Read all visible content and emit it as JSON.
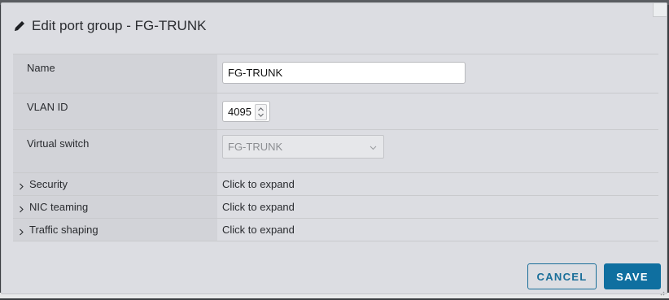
{
  "dialog": {
    "title": "Edit port group - FG-TRUNK",
    "title_icon": "pencil-icon"
  },
  "form": {
    "name_label": "Name",
    "name_value": "FG-TRUNK",
    "vlan_label": "VLAN ID",
    "vlan_value": "4095",
    "vswitch_label": "Virtual switch",
    "vswitch_value": "FG-TRUNK",
    "sections": [
      {
        "label": "Security",
        "value": "Click to expand"
      },
      {
        "label": "NIC teaming",
        "value": "Click to expand"
      },
      {
        "label": "Traffic shaping",
        "value": "Click to expand"
      }
    ]
  },
  "buttons": {
    "cancel": "CANCEL",
    "save": "SAVE"
  },
  "colors": {
    "primary": "#0f6fa0",
    "dialog_bg": "#dcdde2",
    "label_bg": "#d2d3d8"
  }
}
